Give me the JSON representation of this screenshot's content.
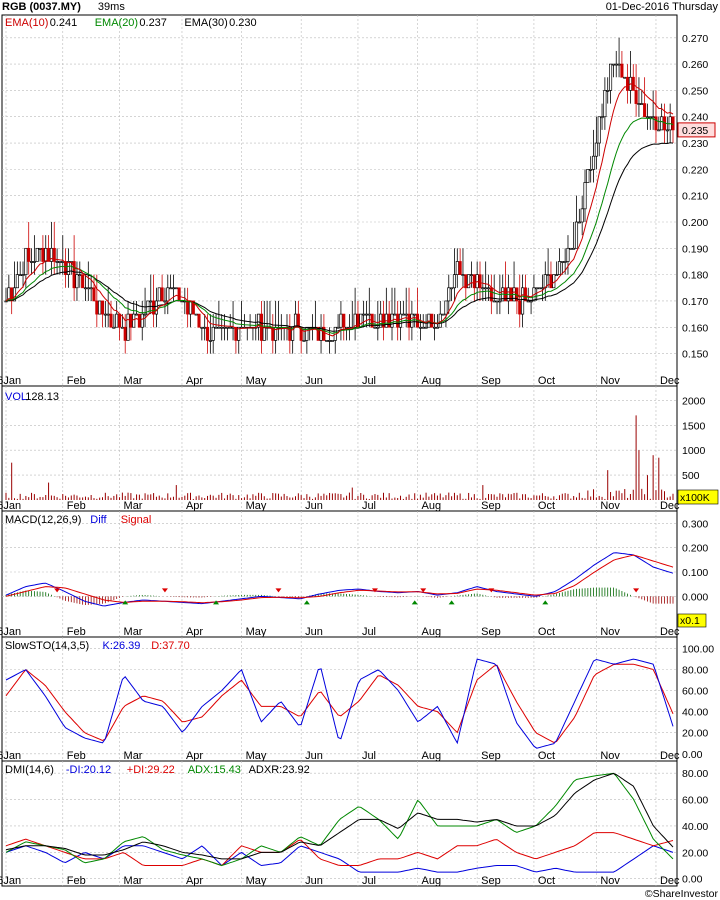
{
  "header": {
    "ticker": "RGB (0037.MY)",
    "render_time": "39ms",
    "date": "01-Dec-2016 Thursday"
  },
  "colors": {
    "price_up": "#000000",
    "price_down": "#cc0000",
    "ema10": "#cc0000",
    "ema20": "#008800",
    "ema30": "#000000",
    "volume": "#990000",
    "diff": "#0000dd",
    "signal": "#dd0000",
    "slow_k": "#0000dd",
    "slow_d": "#dd0000",
    "di_minus": "#0000dd",
    "di_plus": "#dd0000",
    "adx": "#008800",
    "adxr": "#000000",
    "grid": "#bbbbbb",
    "last_price_box": "#ffdddd",
    "scale_box": "#ffff00",
    "buy_arrow": "#008800",
    "sell_arrow": "#dd0000"
  },
  "x_axis": {
    "months": [
      "2016Jan",
      "Feb",
      "Mar",
      "Apr",
      "May",
      "Jun",
      "Jul",
      "Aug",
      "Sep",
      "Oct",
      "Nov",
      "Dec"
    ],
    "total_bars": 236
  },
  "panels": {
    "price": {
      "legend": [
        {
          "label": "EMA(10)",
          "value": "0.241",
          "color": "#cc0000"
        },
        {
          "label": "EMA(20)",
          "value": "0.237",
          "color": "#008800"
        },
        {
          "label": "EMA(30)",
          "value": "0.230",
          "color": "#000000"
        }
      ],
      "ylim": [
        0.143,
        0.276
      ],
      "ticks": [
        "0.150",
        "0.160",
        "0.170",
        "0.180",
        "0.190",
        "0.200",
        "0.210",
        "0.220",
        "0.230",
        "0.240",
        "0.250",
        "0.260",
        "0.270"
      ],
      "last_price": "0.235"
    },
    "volume": {
      "legend": [
        {
          "label": "VOL",
          "value": "128.13",
          "color": "#0000dd"
        }
      ],
      "ylim": [
        0,
        2250
      ],
      "ticks": [
        "500",
        "1000",
        "1500",
        "2000"
      ],
      "scale_note": "x100K"
    },
    "macd": {
      "legend": [
        {
          "label": "MACD(12,26,9)",
          "value": "",
          "color": "#000000"
        },
        {
          "label": "Diff",
          "value": "",
          "color": "#0000dd"
        },
        {
          "label": "Signal",
          "value": "",
          "color": "#dd0000"
        }
      ],
      "ylim": [
        -0.13,
        0.33
      ],
      "ticks": [
        "0.000",
        "0.100",
        "0.200",
        "0.300"
      ],
      "scale_note": "x0.1"
    },
    "slowsto": {
      "legend": [
        {
          "label": "SlowSTO(14,3,5)",
          "value": "",
          "color": "#000000"
        },
        {
          "label": "K:26.39",
          "value": "",
          "color": "#0000dd"
        },
        {
          "label": "D:37.70",
          "value": "",
          "color": "#dd0000"
        }
      ],
      "ylim": [
        -4,
        108
      ],
      "ticks": [
        "0.00",
        "20.00",
        "40.00",
        "60.00",
        "80.00",
        "100.00"
      ]
    },
    "dmi": {
      "legend": [
        {
          "label": "DMI(14,6)",
          "value": "",
          "color": "#000000"
        },
        {
          "label": "-DI:20.12",
          "value": "",
          "color": "#0000dd"
        },
        {
          "label": "+DI:29.22",
          "value": "",
          "color": "#dd0000"
        },
        {
          "label": "ADX:15.43",
          "value": "",
          "color": "#008800"
        },
        {
          "label": "ADXR:23.92",
          "value": "",
          "color": "#000000"
        }
      ],
      "ylim": [
        -4,
        87
      ],
      "ticks": [
        "0.00",
        "20.00",
        "40.00",
        "60.00",
        "80.00"
      ]
    }
  },
  "footer": {
    "copyright": "©ShareInvestor"
  },
  "chart_data": [
    {
      "type": "candlestick",
      "title": "RGB (0037.MY)",
      "x": [
        "2016Jan",
        "Feb",
        "Mar",
        "Apr",
        "May",
        "Jun",
        "Jul",
        "Aug",
        "Sep",
        "Oct",
        "Nov",
        "Dec"
      ],
      "close_anchors": [
        0.17,
        0.185,
        0.19,
        0.185,
        0.175,
        0.165,
        0.16,
        0.165,
        0.175,
        0.17,
        0.16,
        0.155,
        0.16,
        0.16,
        0.158,
        0.16,
        0.155,
        0.16,
        0.165,
        0.165,
        0.165,
        0.16,
        0.165,
        0.18,
        0.175,
        0.17,
        0.17,
        0.172,
        0.18,
        0.195,
        0.23,
        0.26,
        0.25,
        0.24,
        0.235
      ],
      "last_close": 0.235,
      "series": [
        {
          "name": "EMA(10)",
          "last": 0.241
        },
        {
          "name": "EMA(20)",
          "last": 0.237
        },
        {
          "name": "EMA(30)",
          "last": 0.23
        }
      ],
      "ylim": [
        0.143,
        0.276
      ]
    },
    {
      "type": "bar",
      "title": "VOL",
      "units": "x100K",
      "last": 128.13,
      "spikes": [
        [
          2,
          750
        ],
        [
          15,
          350
        ],
        [
          60,
          300
        ],
        [
          122,
          250
        ],
        [
          168,
          300
        ],
        [
          212,
          600
        ],
        [
          222,
          1700
        ],
        [
          223,
          1000
        ],
        [
          226,
          500
        ],
        [
          228,
          900
        ],
        [
          230,
          850
        ]
      ],
      "baseline_range": [
        20,
        150
      ],
      "ylim": [
        0,
        2250
      ]
    },
    {
      "type": "line",
      "title": "MACD(12,26,9)",
      "scale_note": "x0.1",
      "series": [
        {
          "name": "Diff",
          "values": [
            0.005,
            0.04,
            0.055,
            0.02,
            -0.02,
            -0.04,
            -0.025,
            -0.015,
            -0.02,
            -0.025,
            -0.03,
            -0.02,
            -0.01,
            0.0,
            -0.005,
            -0.01,
            0.01,
            0.025,
            0.03,
            0.02,
            0.015,
            0.02,
            0.005,
            0.015,
            0.04,
            0.02,
            0.01,
            0.0,
            0.02,
            0.07,
            0.13,
            0.18,
            0.17,
            0.12,
            0.095
          ]
        },
        {
          "name": "Signal",
          "values": [
            0.0,
            0.02,
            0.04,
            0.035,
            0.01,
            -0.015,
            -0.025,
            -0.02,
            -0.02,
            -0.022,
            -0.026,
            -0.022,
            -0.015,
            -0.005,
            -0.004,
            -0.006,
            0.0,
            0.015,
            0.025,
            0.022,
            0.018,
            0.019,
            0.01,
            0.012,
            0.03,
            0.025,
            0.015,
            0.005,
            0.012,
            0.045,
            0.1,
            0.15,
            0.17,
            0.145,
            0.12
          ]
        }
      ],
      "ylim": [
        -0.13,
        0.33
      ]
    },
    {
      "type": "line",
      "title": "SlowSTO(14,3,5)",
      "series": [
        {
          "name": "K",
          "last": 26.39,
          "values": [
            70,
            80,
            55,
            25,
            15,
            10,
            75,
            50,
            45,
            20,
            45,
            60,
            80,
            30,
            50,
            25,
            85,
            10,
            70,
            80,
            60,
            30,
            45,
            10,
            90,
            85,
            30,
            5,
            10,
            50,
            90,
            85,
            90,
            85,
            26
          ]
        },
        {
          "name": "D",
          "last": 37.7,
          "values": [
            55,
            80,
            65,
            40,
            20,
            12,
            45,
            55,
            50,
            30,
            35,
            55,
            70,
            45,
            45,
            35,
            60,
            35,
            50,
            75,
            65,
            45,
            40,
            20,
            70,
            85,
            50,
            20,
            10,
            35,
            75,
            85,
            85,
            80,
            38
          ]
        }
      ],
      "ylim": [
        -4,
        108
      ]
    },
    {
      "type": "line",
      "title": "DMI(14,6)",
      "series": [
        {
          "name": "-DI",
          "last": 20.12,
          "values": [
            20,
            25,
            20,
            12,
            20,
            15,
            25,
            25,
            20,
            15,
            25,
            10,
            20,
            10,
            12,
            25,
            20,
            15,
            5,
            5,
            5,
            8,
            5,
            5,
            8,
            10,
            10,
            5,
            8,
            5,
            5,
            5,
            15,
            25,
            20
          ]
        },
        {
          "name": "+DI",
          "last": 29.22,
          "values": [
            25,
            30,
            25,
            20,
            15,
            15,
            20,
            10,
            10,
            10,
            15,
            10,
            25,
            20,
            20,
            30,
            15,
            10,
            10,
            15,
            15,
            20,
            15,
            25,
            25,
            30,
            20,
            15,
            20,
            25,
            35,
            35,
            30,
            25,
            29
          ]
        },
        {
          "name": "ADX",
          "last": 15.43,
          "values": [
            20,
            28,
            25,
            22,
            12,
            15,
            28,
            32,
            22,
            18,
            15,
            10,
            15,
            25,
            20,
            32,
            25,
            45,
            55,
            45,
            30,
            60,
            40,
            40,
            40,
            45,
            35,
            40,
            55,
            75,
            78,
            80,
            60,
            30,
            15
          ]
        },
        {
          "name": "ADXR",
          "last": 23.92,
          "values": [
            22,
            25,
            25,
            23,
            18,
            18,
            22,
            28,
            25,
            20,
            18,
            15,
            15,
            20,
            20,
            28,
            25,
            35,
            45,
            45,
            38,
            50,
            45,
            45,
            43,
            45,
            40,
            40,
            48,
            65,
            75,
            80,
            70,
            40,
            24
          ]
        }
      ],
      "ylim": [
        -4,
        87
      ]
    }
  ]
}
